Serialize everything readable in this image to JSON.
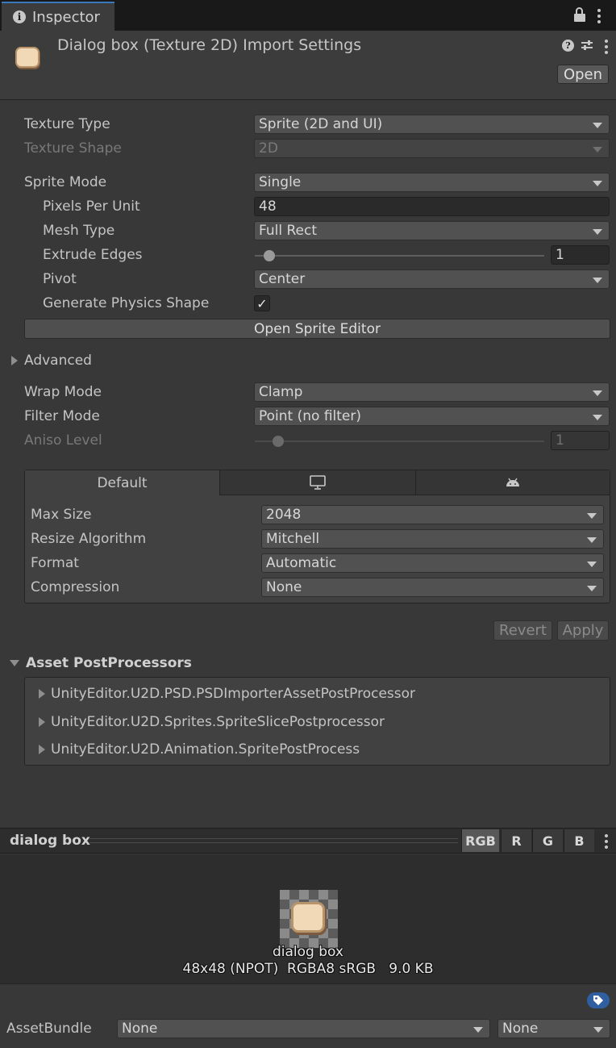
{
  "tab": {
    "title": "Inspector"
  },
  "header": {
    "title": "Dialog box (Texture 2D) Import Settings",
    "open_button": "Open",
    "help_icon": "?"
  },
  "import": {
    "texture_type": {
      "label": "Texture Type",
      "value": "Sprite (2D and UI)"
    },
    "texture_shape": {
      "label": "Texture Shape",
      "value": "2D"
    },
    "sprite_mode": {
      "label": "Sprite Mode",
      "value": "Single"
    },
    "pixels_per_unit": {
      "label": "Pixels Per Unit",
      "value": "48"
    },
    "mesh_type": {
      "label": "Mesh Type",
      "value": "Full Rect"
    },
    "extrude_edges": {
      "label": "Extrude Edges",
      "value": "1"
    },
    "pivot": {
      "label": "Pivot",
      "value": "Center"
    },
    "generate_physics": {
      "label": "Generate Physics Shape",
      "checked": true,
      "check_glyph": "✓"
    },
    "open_sprite_editor": "Open Sprite Editor",
    "advanced": "Advanced",
    "wrap_mode": {
      "label": "Wrap Mode",
      "value": "Clamp"
    },
    "filter_mode": {
      "label": "Filter Mode",
      "value": "Point (no filter)"
    },
    "aniso_level": {
      "label": "Aniso Level",
      "value": "1"
    }
  },
  "platform": {
    "tabs": [
      {
        "label": "Default",
        "icon": ""
      },
      {
        "label": "",
        "icon": "monitor-icon"
      },
      {
        "label": "",
        "icon": "android-icon"
      }
    ],
    "max_size": {
      "label": "Max Size",
      "value": "2048"
    },
    "resize_algorithm": {
      "label": "Resize Algorithm",
      "value": "Mitchell"
    },
    "format": {
      "label": "Format",
      "value": "Automatic"
    },
    "compression": {
      "label": "Compression",
      "value": "None"
    }
  },
  "actions": {
    "revert": "Revert",
    "apply": "Apply"
  },
  "postprocessors": {
    "title": "Asset PostProcessors",
    "items": [
      "UnityEditor.U2D.PSD.PSDImporterAssetPostProcessor",
      "UnityEditor.U2D.Sprites.SpriteSlicePostprocessor",
      "UnityEditor.U2D.Animation.SpritePostProcess"
    ]
  },
  "preview": {
    "title": "dialog box",
    "channels": [
      "RGB",
      "R",
      "G",
      "B"
    ],
    "active_channel": "RGB",
    "name": "dialog box",
    "info": "48x48 (NPOT)  RGBA8 sRGB   9.0 KB"
  },
  "asset_bundle": {
    "label": "AssetBundle",
    "name_value": "None",
    "variant_value": "None"
  },
  "colors": {
    "accent": "#3a79bb",
    "panel": "#383838",
    "sprite_fill": "#f1d9b8"
  }
}
